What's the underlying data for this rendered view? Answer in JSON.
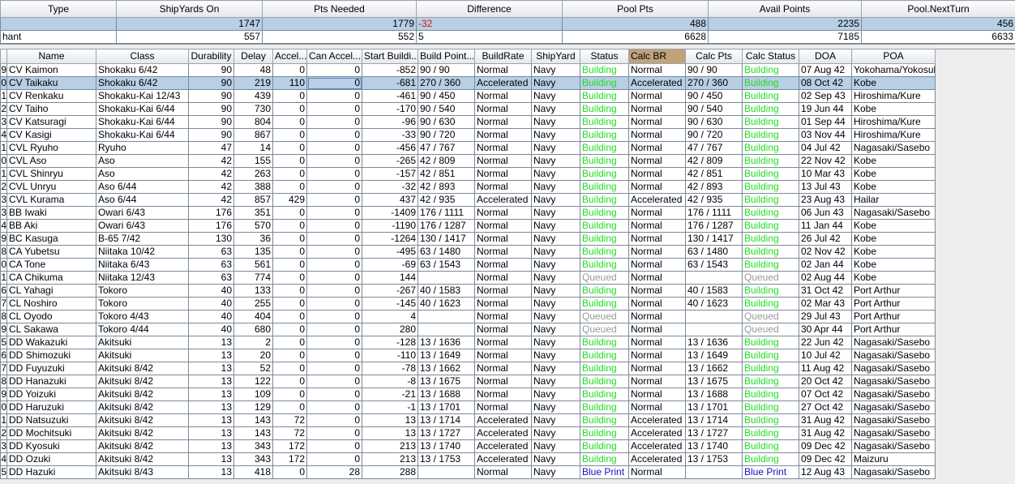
{
  "summary": {
    "headers": [
      "Type",
      "ShipYards On",
      "Pts Needed",
      "Difference",
      "Pool Pts",
      "Avail Points",
      "Pool.NextTurn"
    ],
    "rows": [
      [
        "",
        "1747",
        "1779",
        "-32",
        "488",
        "2235",
        "456"
      ],
      [
        "hant",
        "557",
        "552",
        "5",
        "6628",
        "7185",
        "6633"
      ]
    ]
  },
  "ships": {
    "headers": [
      "",
      "Name",
      "Class",
      "Durability",
      "Delay",
      "Accel...",
      "Can Accel...",
      "Start Buildi...",
      "Build Point...",
      "BuildRate",
      "ShipYard",
      "Status",
      "Calc BR",
      "Calc Pts",
      "Calc Status",
      "DOA",
      "POA"
    ],
    "rows": [
      [
        "9",
        "CV Kaimon",
        "Shokaku 6/42",
        "90",
        "48",
        "0",
        "0",
        "-852",
        "90 / 90",
        "Normal",
        "Navy",
        "Building",
        "Normal",
        "90 / 90",
        "Building",
        "07 Aug 42",
        "Yokohama/Yokosuka"
      ],
      [
        "0",
        "CV Taikaku",
        "Shokaku 6/42",
        "90",
        "219",
        "110",
        "0",
        "-681",
        "270 / 360",
        "Accelerated",
        "Navy",
        "Building",
        "Accelerated",
        "270 / 360",
        "Building",
        "08 Oct 42",
        "Kobe"
      ],
      [
        "1",
        "CV Renkaku",
        "Shokaku-Kai 12/43",
        "90",
        "439",
        "0",
        "0",
        "-461",
        "90 / 450",
        "Normal",
        "Navy",
        "Building",
        "Normal",
        "90 / 450",
        "Building",
        "02 Sep 43",
        "Hiroshima/Kure"
      ],
      [
        "2",
        "CV Taiho",
        "Shokaku-Kai 6/44",
        "90",
        "730",
        "0",
        "0",
        "-170",
        "90 / 540",
        "Normal",
        "Navy",
        "Building",
        "Normal",
        "90 / 540",
        "Building",
        "19 Jun 44",
        "Kobe"
      ],
      [
        "3",
        "CV Katsuragi",
        "Shokaku-Kai 6/44",
        "90",
        "804",
        "0",
        "0",
        "-96",
        "90 / 630",
        "Normal",
        "Navy",
        "Building",
        "Normal",
        "90 / 630",
        "Building",
        "01 Sep 44",
        "Hiroshima/Kure"
      ],
      [
        "4",
        "CV Kasigi",
        "Shokaku-Kai 6/44",
        "90",
        "867",
        "0",
        "0",
        "-33",
        "90 / 720",
        "Normal",
        "Navy",
        "Building",
        "Normal",
        "90 / 720",
        "Building",
        "03 Nov 44",
        "Hiroshima/Kure"
      ],
      [
        "1",
        "CVL Ryuho",
        "Ryuho",
        "47",
        "14",
        "0",
        "0",
        "-456",
        "47 / 767",
        "Normal",
        "Navy",
        "Building",
        "Normal",
        "47 / 767",
        "Building",
        "04 Jul 42",
        "Nagasaki/Sasebo"
      ],
      [
        "0",
        "CVL Aso",
        "Aso",
        "42",
        "155",
        "0",
        "0",
        "-265",
        "42 / 809",
        "Normal",
        "Navy",
        "Building",
        "Normal",
        "42 / 809",
        "Building",
        "22 Nov 42",
        "Kobe"
      ],
      [
        "1",
        "CVL Shinryu",
        "Aso",
        "42",
        "263",
        "0",
        "0",
        "-157",
        "42 / 851",
        "Normal",
        "Navy",
        "Building",
        "Normal",
        "42 / 851",
        "Building",
        "10 Mar 43",
        "Kobe"
      ],
      [
        "2",
        "CVL Unryu",
        "Aso 6/44",
        "42",
        "388",
        "0",
        "0",
        "-32",
        "42 / 893",
        "Normal",
        "Navy",
        "Building",
        "Normal",
        "42 / 893",
        "Building",
        "13 Jul 43",
        "Kobe"
      ],
      [
        "3",
        "CVL Kurama",
        "Aso 6/44",
        "42",
        "857",
        "429",
        "0",
        "437",
        "42 / 935",
        "Accelerated",
        "Navy",
        "Building",
        "Accelerated",
        "42 / 935",
        "Building",
        "23 Aug 43",
        "Hailar"
      ],
      [
        "3",
        "BB Iwaki",
        "Owari 6/43",
        "176",
        "351",
        "0",
        "0",
        "-1409",
        "176 / 1111",
        "Normal",
        "Navy",
        "Building",
        "Normal",
        "176 / 1111",
        "Building",
        "06 Jun 43",
        "Nagasaki/Sasebo"
      ],
      [
        "4",
        "BB Aki",
        "Owari 6/43",
        "176",
        "570",
        "0",
        "0",
        "-1190",
        "176 / 1287",
        "Normal",
        "Navy",
        "Building",
        "Normal",
        "176 / 1287",
        "Building",
        "11 Jan 44",
        "Kobe"
      ],
      [
        "9",
        "BC Kasuga",
        "B-65 7/42",
        "130",
        "36",
        "0",
        "0",
        "-1264",
        "130 / 1417",
        "Normal",
        "Navy",
        "Building",
        "Normal",
        "130 / 1417",
        "Building",
        "26 Jul 42",
        "Kobe"
      ],
      [
        "8",
        "CA Yubetsu",
        "Niitaka 10/42",
        "63",
        "135",
        "0",
        "0",
        "-495",
        "63 / 1480",
        "Normal",
        "Navy",
        "Building",
        "Normal",
        "63 / 1480",
        "Building",
        "02 Nov 42",
        "Kobe"
      ],
      [
        "0",
        "CA Tone",
        "Niitaka 6/43",
        "63",
        "561",
        "0",
        "0",
        "-69",
        "63 / 1543",
        "Normal",
        "Navy",
        "Building",
        "Normal",
        "63 / 1543",
        "Building",
        "02 Jan 44",
        "Kobe"
      ],
      [
        "1",
        "CA Chikuma",
        "Niitaka 12/43",
        "63",
        "774",
        "0",
        "0",
        "144",
        "",
        "Normal",
        "Navy",
        "Queued",
        "Normal",
        "",
        "Queued",
        "02 Aug 44",
        "Kobe"
      ],
      [
        "6",
        "CL Yahagi",
        "Tokoro",
        "40",
        "133",
        "0",
        "0",
        "-267",
        "40 / 1583",
        "Normal",
        "Navy",
        "Building",
        "Normal",
        "40 / 1583",
        "Building",
        "31 Oct 42",
        "Port Arthur"
      ],
      [
        "7",
        "CL Noshiro",
        "Tokoro",
        "40",
        "255",
        "0",
        "0",
        "-145",
        "40 / 1623",
        "Normal",
        "Navy",
        "Building",
        "Normal",
        "40 / 1623",
        "Building",
        "02 Mar 43",
        "Port Arthur"
      ],
      [
        "8",
        "CL Oyodo",
        "Tokoro 4/43",
        "40",
        "404",
        "0",
        "0",
        "4",
        "",
        "Normal",
        "Navy",
        "Queued",
        "Normal",
        "",
        "Queued",
        "29 Jul 43",
        "Port Arthur"
      ],
      [
        "9",
        "CL Sakawa",
        "Tokoro 4/44",
        "40",
        "680",
        "0",
        "0",
        "280",
        "",
        "Normal",
        "Navy",
        "Queued",
        "Normal",
        "",
        "Queued",
        "30 Apr 44",
        "Port Arthur"
      ],
      [
        "5",
        "DD Wakazuki",
        "Akitsuki",
        "13",
        "2",
        "0",
        "0",
        "-128",
        "13 / 1636",
        "Normal",
        "Navy",
        "Building",
        "Normal",
        "13 / 1636",
        "Building",
        "22 Jun 42",
        "Nagasaki/Sasebo"
      ],
      [
        "6",
        "DD Shimozuki",
        "Akitsuki",
        "13",
        "20",
        "0",
        "0",
        "-110",
        "13 / 1649",
        "Normal",
        "Navy",
        "Building",
        "Normal",
        "13 / 1649",
        "Building",
        "10 Jul 42",
        "Nagasaki/Sasebo"
      ],
      [
        "7",
        "DD Fuyuzuki",
        "Akitsuki 8/42",
        "13",
        "52",
        "0",
        "0",
        "-78",
        "13 / 1662",
        "Normal",
        "Navy",
        "Building",
        "Normal",
        "13 / 1662",
        "Building",
        "11 Aug 42",
        "Nagasaki/Sasebo"
      ],
      [
        "8",
        "DD Hanazuki",
        "Akitsuki 8/42",
        "13",
        "122",
        "0",
        "0",
        "-8",
        "13 / 1675",
        "Normal",
        "Navy",
        "Building",
        "Normal",
        "13 / 1675",
        "Building",
        "20 Oct 42",
        "Nagasaki/Sasebo"
      ],
      [
        "9",
        "DD Yoizuki",
        "Akitsuki 8/42",
        "13",
        "109",
        "0",
        "0",
        "-21",
        "13 / 1688",
        "Normal",
        "Navy",
        "Building",
        "Normal",
        "13 / 1688",
        "Building",
        "07 Oct 42",
        "Nagasaki/Sasebo"
      ],
      [
        "0",
        "DD Haruzuki",
        "Akitsuki 8/42",
        "13",
        "129",
        "0",
        "0",
        "-1",
        "13 / 1701",
        "Normal",
        "Navy",
        "Building",
        "Normal",
        "13 / 1701",
        "Building",
        "27 Oct 42",
        "Nagasaki/Sasebo"
      ],
      [
        "1",
        "DD Natsuzuki",
        "Akitsuki 8/42",
        "13",
        "143",
        "72",
        "0",
        "13",
        "13 / 1714",
        "Accelerated",
        "Navy",
        "Building",
        "Accelerated",
        "13 / 1714",
        "Building",
        "31 Aug 42",
        "Nagasaki/Sasebo"
      ],
      [
        "2",
        "DD Mochitsuki",
        "Akitsuki 8/42",
        "13",
        "143",
        "72",
        "0",
        "13",
        "13 / 1727",
        "Accelerated",
        "Navy",
        "Building",
        "Accelerated",
        "13 / 1727",
        "Building",
        "31 Aug 42",
        "Nagasaki/Sasebo"
      ],
      [
        "3",
        "DD Kyosuki",
        "Akitsuki 8/42",
        "13",
        "343",
        "172",
        "0",
        "213",
        "13 / 1740",
        "Accelerated",
        "Navy",
        "Building",
        "Accelerated",
        "13 / 1740",
        "Building",
        "09 Dec 42",
        "Nagasaki/Sasebo"
      ],
      [
        "4",
        "DD Ozuki",
        "Akitsuki 8/42",
        "13",
        "343",
        "172",
        "0",
        "213",
        "13 / 1753",
        "Accelerated",
        "Navy",
        "Building",
        "Accelerated",
        "13 / 1753",
        "Building",
        "09 Dec 42",
        "Maizuru"
      ],
      [
        "5",
        "DD Hazuki",
        "Akitsuki 8/43",
        "13",
        "418",
        "0",
        "28",
        "288",
        "",
        "Normal",
        "Navy",
        "Blue Print",
        "Normal",
        "",
        "Blue Print",
        "12 Aug 43",
        "Nagasaki/Sasebo"
      ]
    ]
  },
  "selected_row": 1,
  "colors": {
    "building": "#22dd22",
    "queued": "#999999",
    "blue_print": "#1010cc",
    "negative": "#e01010",
    "selection": "#b8cfe5",
    "calc_br_header": "#c0a27b"
  }
}
